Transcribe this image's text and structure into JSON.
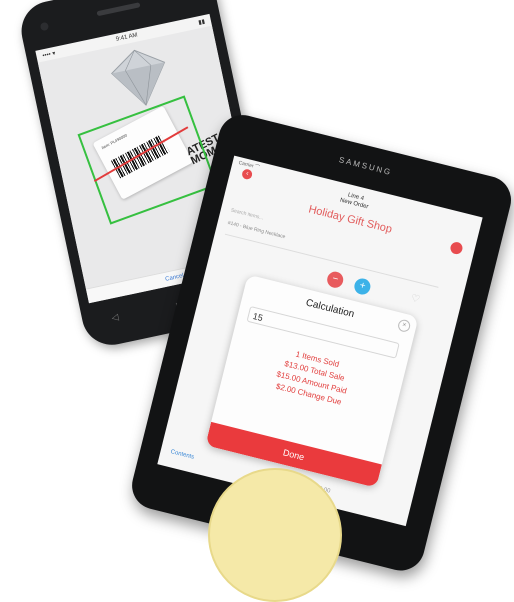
{
  "phone": {
    "status_left": "•••• ▾",
    "status_time": "9:41 AM",
    "status_right": "▮▮",
    "tag_text": "Item: PL490000",
    "latest_tag": "ATEST\nMOM",
    "cancel_label": "Cancel"
  },
  "tablet": {
    "brand": "SAMSUNG",
    "status": "Carrier ⌒",
    "nav_title_line1": "Line 4",
    "nav_title_line2": "New Order",
    "shop_title": "Holiday Gift Shop",
    "search_placeholder": "Search items...",
    "item_label": "#140 - Blue Ring Necklace",
    "minus_label": "−",
    "plus_label": "+",
    "modal": {
      "title": "Calculation",
      "amount_value": "15",
      "lines": [
        "1 Items Sold",
        "$13.00 Total Sale",
        "$15.00 Amount Paid",
        "$2.00 Change Due"
      ],
      "done_label": "Done"
    },
    "bottom_left": "Contents",
    "bottom_right": "Total: $13.00"
  }
}
